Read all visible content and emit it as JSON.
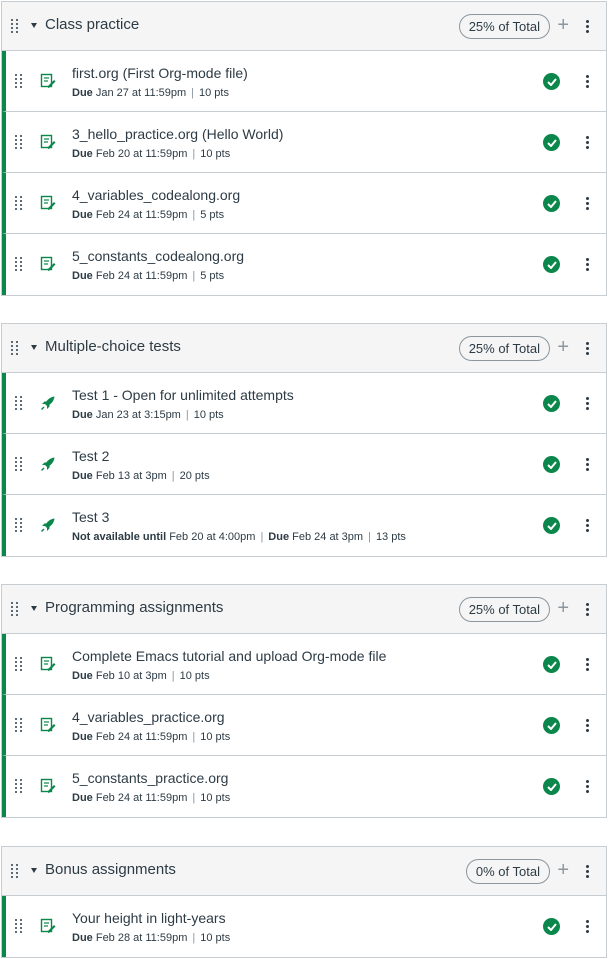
{
  "colors": {
    "published": "#0b874b",
    "text": "#2d3b45",
    "border": "#c7cdd1",
    "header_bg": "#f5f5f5"
  },
  "groups": [
    {
      "title": "Class practice",
      "weight": "25% of Total",
      "items": [
        {
          "icon": "assignment-icon",
          "title": "first.org (First Org-mode file)",
          "due_label": "Due",
          "due": "Jan 27 at 11:59pm",
          "points": "10 pts"
        },
        {
          "icon": "assignment-icon",
          "title": "3_hello_practice.org (Hello World)",
          "due_label": "Due",
          "due": "Feb 20 at 11:59pm",
          "points": "10 pts"
        },
        {
          "icon": "assignment-icon",
          "title": "4_variables_codealong.org",
          "due_label": "Due",
          "due": "Feb 24 at 11:59pm",
          "points": "5 pts"
        },
        {
          "icon": "assignment-icon",
          "title": "5_constants_codealong.org",
          "due_label": "Due",
          "due": "Feb 24 at 11:59pm",
          "points": "5 pts"
        }
      ]
    },
    {
      "title": "Multiple-choice tests",
      "weight": "25% of Total",
      "items": [
        {
          "icon": "quiz-rocket-icon",
          "title": "Test 1 - Open for unlimited attempts",
          "due_label": "Due",
          "due": "Jan 23 at 3:15pm",
          "points": "10 pts"
        },
        {
          "icon": "quiz-rocket-icon",
          "title": "Test 2",
          "due_label": "Due",
          "due": "Feb 13 at 3pm",
          "points": "20 pts"
        },
        {
          "icon": "quiz-rocket-icon",
          "title": "Test 3",
          "avail_label": "Not available until",
          "avail": "Feb 20 at 4:00pm",
          "due_label": "Due",
          "due": "Feb 24 at 3pm",
          "points": "13 pts"
        }
      ]
    },
    {
      "title": "Programming assignments",
      "weight": "25% of Total",
      "items": [
        {
          "icon": "assignment-icon",
          "title": "Complete Emacs tutorial and upload Org-mode file",
          "due_label": "Due",
          "due": "Feb 10 at 3pm",
          "points": "10 pts"
        },
        {
          "icon": "assignment-icon",
          "title": "4_variables_practice.org",
          "due_label": "Due",
          "due": "Feb 24 at 11:59pm",
          "points": "10 pts"
        },
        {
          "icon": "assignment-icon",
          "title": "5_constants_practice.org",
          "due_label": "Due",
          "due": "Feb 24 at 11:59pm",
          "points": "10 pts"
        }
      ]
    },
    {
      "title": "Bonus assignments",
      "weight": "0% of Total",
      "items": [
        {
          "icon": "assignment-icon",
          "title": "Your height in light-years",
          "due_label": "Due",
          "due": "Feb 28 at 11:59pm",
          "points": "10 pts"
        }
      ]
    }
  ]
}
